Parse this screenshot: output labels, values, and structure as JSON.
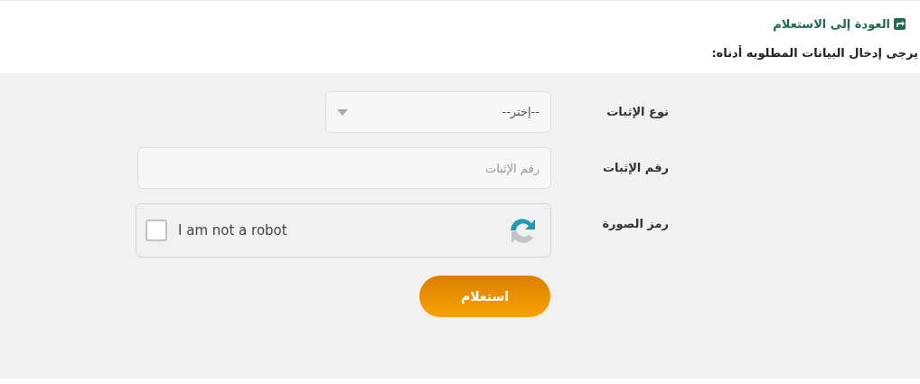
{
  "back_link": {
    "label": "العودة إلى الاستعلام"
  },
  "instruction": "يرجى إدخال البيانات المطلوبه أدناه:",
  "form": {
    "fields": [
      {
        "kind": "select",
        "label": "نوع الإثبات",
        "value": "--إختر--"
      },
      {
        "kind": "text",
        "label": "رقم الإثبات",
        "placeholder": "رقم الإثبات"
      },
      {
        "kind": "captcha",
        "label": "رمز الصورة",
        "text": "I am not a robot",
        "checked": false
      }
    ],
    "submit": "استعلام"
  }
}
